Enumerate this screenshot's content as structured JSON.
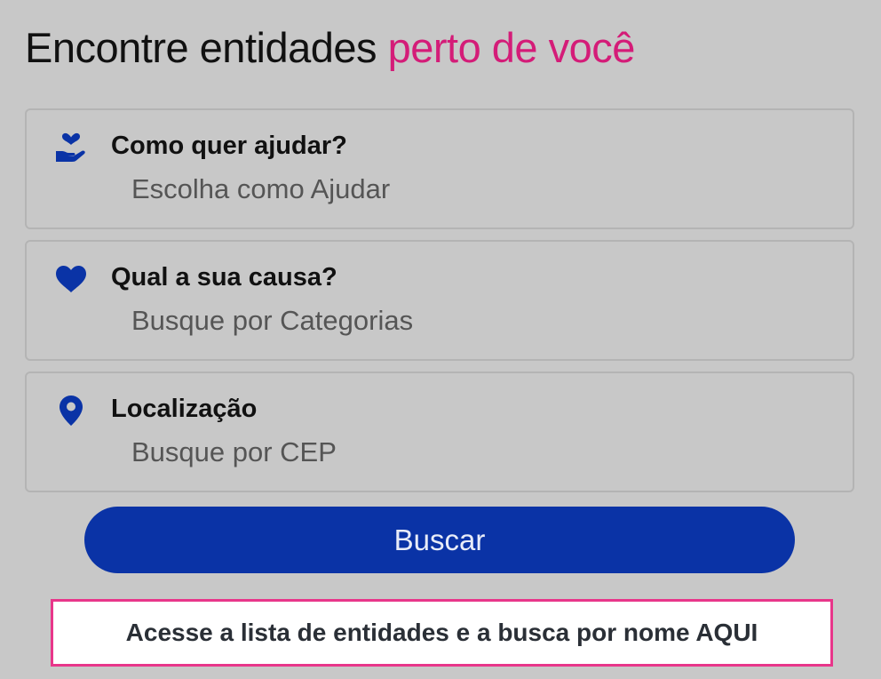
{
  "header": {
    "title_part1": "Encontre entidades",
    "title_accent": "perto de você"
  },
  "fields": [
    {
      "icon": "hand-heart-icon",
      "label": "Como quer ajudar?",
      "placeholder": "Escolha como Ajudar"
    },
    {
      "icon": "heart-icon",
      "label": "Qual a sua causa?",
      "placeholder": "Busque por Categorias"
    },
    {
      "icon": "location-pin-icon",
      "label": "Localização",
      "placeholder": "Busque por CEP"
    }
  ],
  "search_button": {
    "label": "Buscar"
  },
  "list_link": {
    "label": "Acesse a lista de entidades e a busca por nome AQUI"
  },
  "colors": {
    "background": "#c8c8c8",
    "accent": "#d41c78",
    "primary": "#0a33a6",
    "link_border": "#e8368a"
  }
}
